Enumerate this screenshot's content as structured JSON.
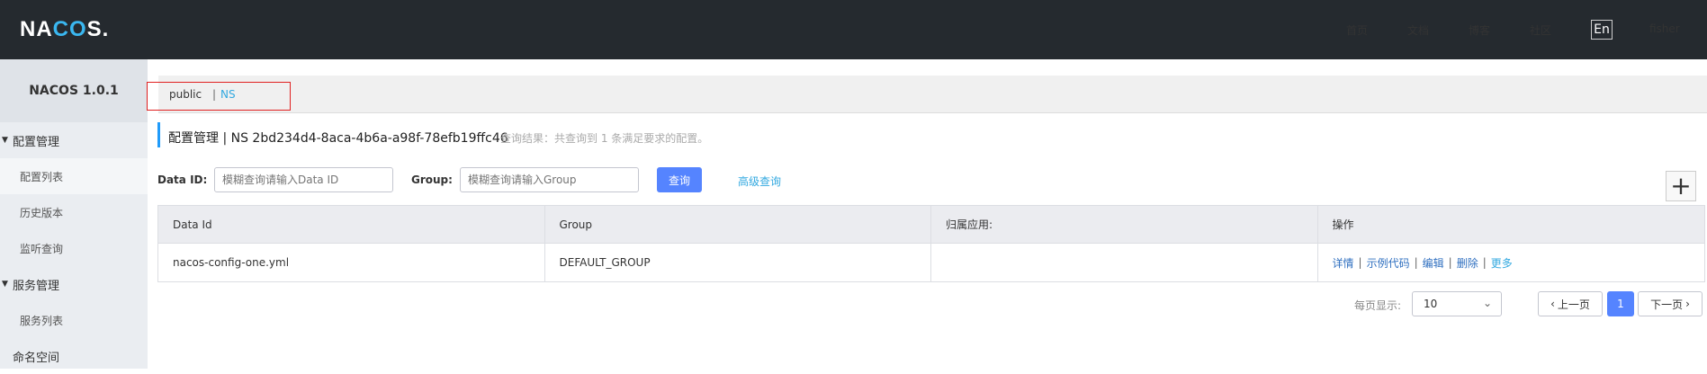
{
  "header": {
    "logo_left": "NA",
    "logo_co": "CO",
    "logo_right": "S.",
    "nav": [
      "首页",
      "文档",
      "博客",
      "社区"
    ],
    "lang_button": "En",
    "user": "fisher"
  },
  "sidebar": {
    "title": "NACOS 1.0.1",
    "config_group": "配置管理",
    "config_items": [
      "配置列表",
      "历史版本",
      "监听查询"
    ],
    "service_group": "服务管理",
    "service_items": [
      "服务列表"
    ],
    "namespace": "命名空间"
  },
  "namespace_bar": {
    "public": "public",
    "separator": "|",
    "ns": "NS"
  },
  "title": {
    "text": "配置管理  |  NS  2bd234d4-8aca-4b6a-a98f-78efb19ffc46",
    "result": "查询结果：共查询到 1 条满足要求的配置。"
  },
  "search": {
    "dataid_label": "Data ID:",
    "dataid_placeholder": "模糊查询请输入Data ID",
    "group_label": "Group:",
    "group_placeholder": "模糊查询请输入Group",
    "query_button": "查询",
    "advanced_link": "高级查询",
    "add_icon": "plus-icon"
  },
  "table": {
    "columns": [
      "Data Id",
      "Group",
      "归属应用:",
      "操作"
    ],
    "rows": [
      {
        "data_id": "nacos-config-one.yml",
        "group": "DEFAULT_GROUP",
        "app": "",
        "ops": [
          "详情",
          "示例代码",
          "编辑",
          "删除",
          "更多"
        ]
      }
    ]
  },
  "pagination": {
    "per_page_label": "每页显示:",
    "per_page_value": "10",
    "prev": "上一页",
    "current_page": "1",
    "next": "下一页"
  },
  "colors": {
    "header_bg": "#252a2f",
    "accent": "#5584ff",
    "link": "#33a9e0",
    "highlight_box": "#e02020"
  }
}
